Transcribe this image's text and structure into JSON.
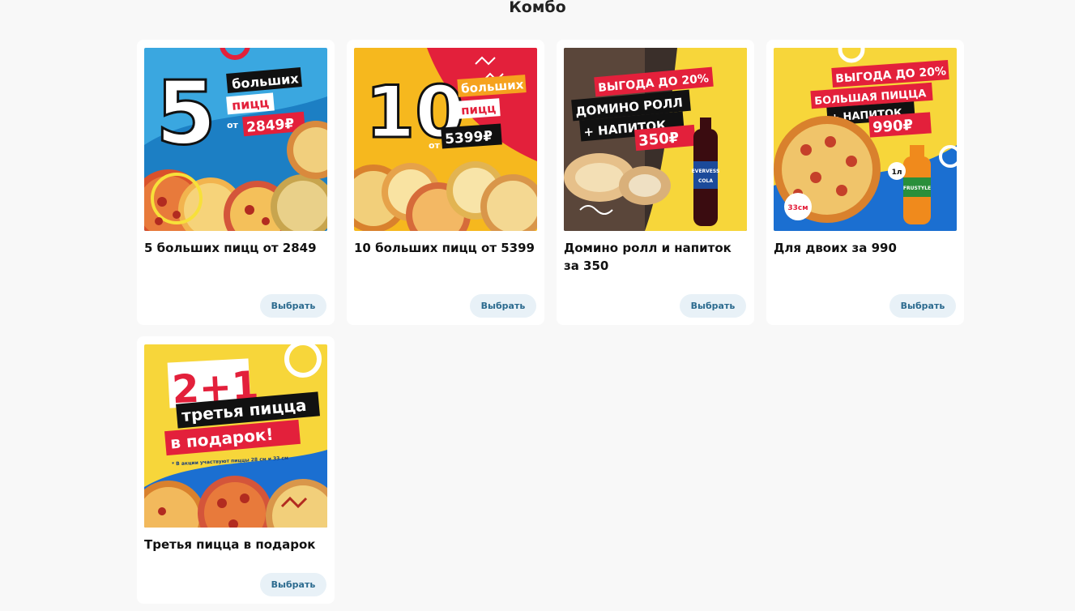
{
  "section": {
    "title": "Комбо"
  },
  "button_label": "Выбрать",
  "cards": [
    {
      "title": "5 больших пицц от 2849",
      "promo": {
        "big": "5",
        "line1": "больших",
        "line2": "пицц",
        "from": "от",
        "price": "2849₽"
      }
    },
    {
      "title": "10 больших пицц от 5399",
      "promo": {
        "big": "10",
        "line1": "больших",
        "line2": "пицц",
        "from": "от",
        "price": "5399₽"
      }
    },
    {
      "title": "Домино ролл и напиток за 350",
      "promo": {
        "badge": "ВЫГОДА ДО 20%",
        "line1": "ДОМИНО РОЛЛ",
        "line2": "+ НАПИТОК",
        "price": "350₽",
        "bottle_brand": "EVERVESS",
        "bottle_sub": "COLA"
      }
    },
    {
      "title": "Для двоих за 990",
      "promo": {
        "badge": "ВЫГОДА ДО 20%",
        "line1": "БОЛЬШАЯ ПИЦЦА",
        "line2": "+ НАПИТОК",
        "price": "990₽",
        "size": "33см",
        "volume": "1л",
        "bottle_brand": "FRUSTYLE"
      }
    },
    {
      "title": "Третья пицца в подарок",
      "promo": {
        "big": "2+1",
        "line1": "третья пицца",
        "line2": "в подарок!",
        "note": "* В акции участвуют пиццы 28 см и 33 см"
      }
    }
  ],
  "colors": {
    "page_bg": "#f8f8f8",
    "button_bg": "#e8f1f7",
    "button_text": "#2c6b8f",
    "promo_red": "#e3203b",
    "promo_yellow": "#f7d63a",
    "promo_blue": "#1b6fd1"
  }
}
